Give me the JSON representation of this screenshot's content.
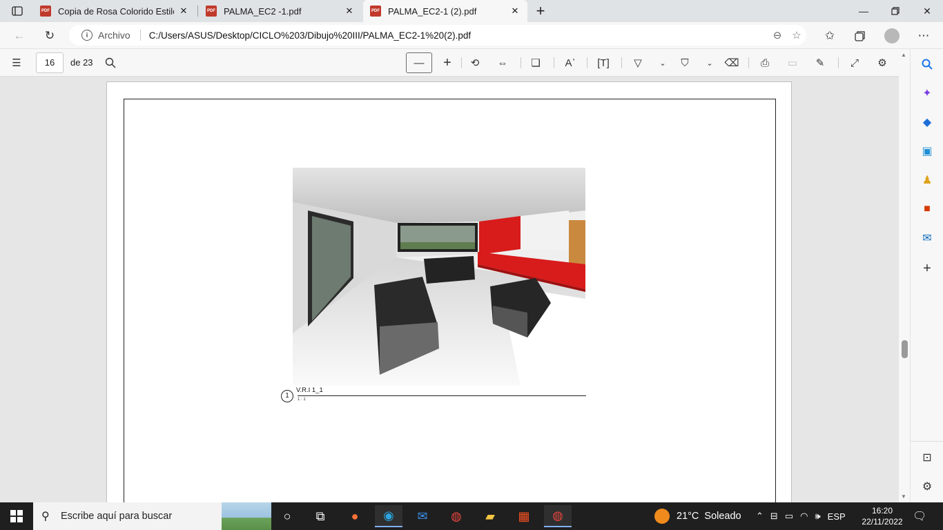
{
  "tabs": [
    {
      "label": "Copia de Rosa Colorido Estilo Se",
      "active": false
    },
    {
      "label": "PALMA_EC2 -1.pdf",
      "active": false
    },
    {
      "label": "PALMA_EC2-1 (2).pdf",
      "active": true
    }
  ],
  "tab_icon_text": "PDF",
  "address": {
    "scheme_label": "Archivo",
    "url": "C:/Users/ASUS/Desktop/CICLO%203/Dibujo%20III/PALMA_EC2-1%20(2).pdf"
  },
  "pdf_toolbar": {
    "current_page": "16",
    "page_count_label": "de 23"
  },
  "document": {
    "view_number": "1",
    "view_title": "V.R.I 1_1",
    "view_scale": "1 : 1"
  },
  "taskbar": {
    "search_placeholder": "Escribe aquí para buscar",
    "weather_temp": "21°C",
    "weather_desc": "Soleado",
    "language": "ESP",
    "time": "16:20",
    "date": "22/11/2022"
  },
  "colors": {
    "tab_strip": "#dfe3e6",
    "chrome": "#f7f7f7",
    "doc_bg": "#e6e6e6",
    "taskbar": "#1f1f1f",
    "accent_red": "#d81b1b"
  }
}
